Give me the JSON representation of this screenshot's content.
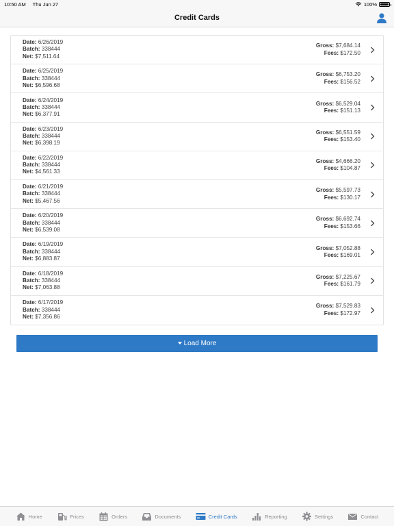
{
  "status_bar": {
    "time": "10:50 AM",
    "date": "Thu Jun 27",
    "battery": "100%"
  },
  "header": {
    "title": "Credit Cards"
  },
  "labels": {
    "date": "Date:",
    "batch": "Batch:",
    "net": "Net:",
    "gross": "Gross:",
    "fees": "Fees:"
  },
  "rows": [
    {
      "date": "6/26/2019",
      "batch": "338444",
      "net": "$7,511.64",
      "gross": "$7,684.14",
      "fees": "$172.50"
    },
    {
      "date": "6/25/2019",
      "batch": "338444",
      "net": "$6,596.68",
      "gross": "$6,753.20",
      "fees": "$156.52"
    },
    {
      "date": "6/24/2019",
      "batch": "338444",
      "net": "$6,377.91",
      "gross": "$6,529.04",
      "fees": "$151.13"
    },
    {
      "date": "6/23/2019",
      "batch": "338444",
      "net": "$6,398.19",
      "gross": "$6,551.59",
      "fees": "$153.40"
    },
    {
      "date": "6/22/2019",
      "batch": "338444",
      "net": "$4,561.33",
      "gross": "$4,666.20",
      "fees": "$104.87"
    },
    {
      "date": "6/21/2019",
      "batch": "338444",
      "net": "$5,467.56",
      "gross": "$5,597.73",
      "fees": "$130.17"
    },
    {
      "date": "6/20/2019",
      "batch": "338444",
      "net": "$6,539.08",
      "gross": "$6,692.74",
      "fees": "$153.66"
    },
    {
      "date": "6/19/2019",
      "batch": "338444",
      "net": "$6,883.87",
      "gross": "$7,052.88",
      "fees": "$169.01"
    },
    {
      "date": "6/18/2019",
      "batch": "338444",
      "net": "$7,063.88",
      "gross": "$7,225.67",
      "fees": "$161.79"
    },
    {
      "date": "6/17/2019",
      "batch": "338444",
      "net": "$7,356.86",
      "gross": "$7,529.83",
      "fees": "$172.97"
    }
  ],
  "load_more": {
    "label": "Load More"
  },
  "tabs": [
    {
      "label": "Home",
      "icon": "home-icon"
    },
    {
      "label": "Prices",
      "icon": "fuel-pump-icon"
    },
    {
      "label": "Orders",
      "icon": "calendar-icon"
    },
    {
      "label": "Documents",
      "icon": "inbox-icon"
    },
    {
      "label": "Credit Cards",
      "icon": "credit-card-icon",
      "active": true
    },
    {
      "label": "Reporting",
      "icon": "bar-chart-icon"
    },
    {
      "label": "Settings",
      "icon": "gear-icon"
    },
    {
      "label": "Contact",
      "icon": "envelope-icon"
    }
  ],
  "colors": {
    "accent": "#2f7ac6",
    "tab_inactive": "#8e8e93"
  }
}
